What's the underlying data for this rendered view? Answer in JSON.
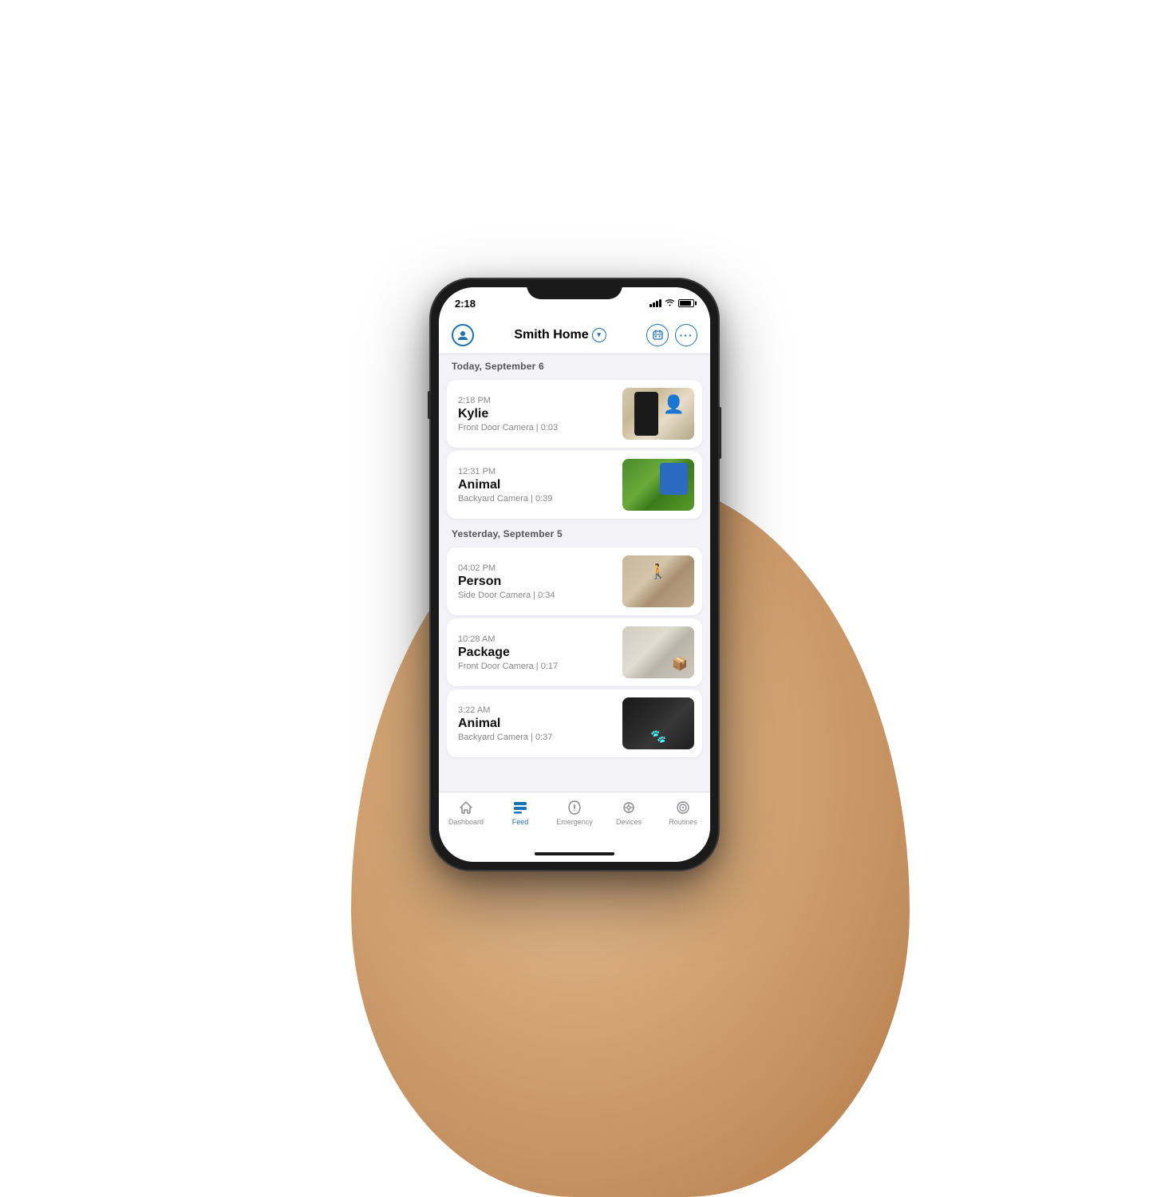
{
  "status_bar": {
    "time": "2:18",
    "signal": "signal",
    "wifi": "wifi",
    "battery": "battery"
  },
  "header": {
    "profile_icon": "person-icon",
    "title": "Smith Home",
    "chevron_icon": "chevron-down-icon",
    "calendar_icon": "calendar-icon",
    "more_icon": "more-icon"
  },
  "sections": [
    {
      "label": "Today, September 6",
      "items": [
        {
          "time": "2:18 PM",
          "label": "Kylie",
          "source": "Front Door Camera | 0:03",
          "thumb_type": "kylie"
        },
        {
          "time": "12:31 PM",
          "label": "Animal",
          "source": "Backyard Camera | 0:39",
          "thumb_type": "animal-backyard"
        }
      ]
    },
    {
      "label": "Yesterday, September 5",
      "items": [
        {
          "time": "04:02 PM",
          "label": "Person",
          "source": "Side Door Camera | 0:34",
          "thumb_type": "person"
        },
        {
          "time": "10:28 AM",
          "label": "Package",
          "source": "Front Door Camera | 0:17",
          "thumb_type": "package"
        },
        {
          "time": "3:22 AM",
          "label": "Animal",
          "source": "Backyard Camera | 0:37",
          "thumb_type": "animal-night"
        }
      ]
    }
  ],
  "bottom_nav": {
    "items": [
      {
        "id": "dashboard",
        "label": "Dashboard",
        "active": false
      },
      {
        "id": "feed",
        "label": "Feed",
        "active": true
      },
      {
        "id": "emergency",
        "label": "Emergency",
        "active": false
      },
      {
        "id": "devices",
        "label": "Devices",
        "active": false
      },
      {
        "id": "routines",
        "label": "Routines",
        "active": false
      }
    ]
  }
}
